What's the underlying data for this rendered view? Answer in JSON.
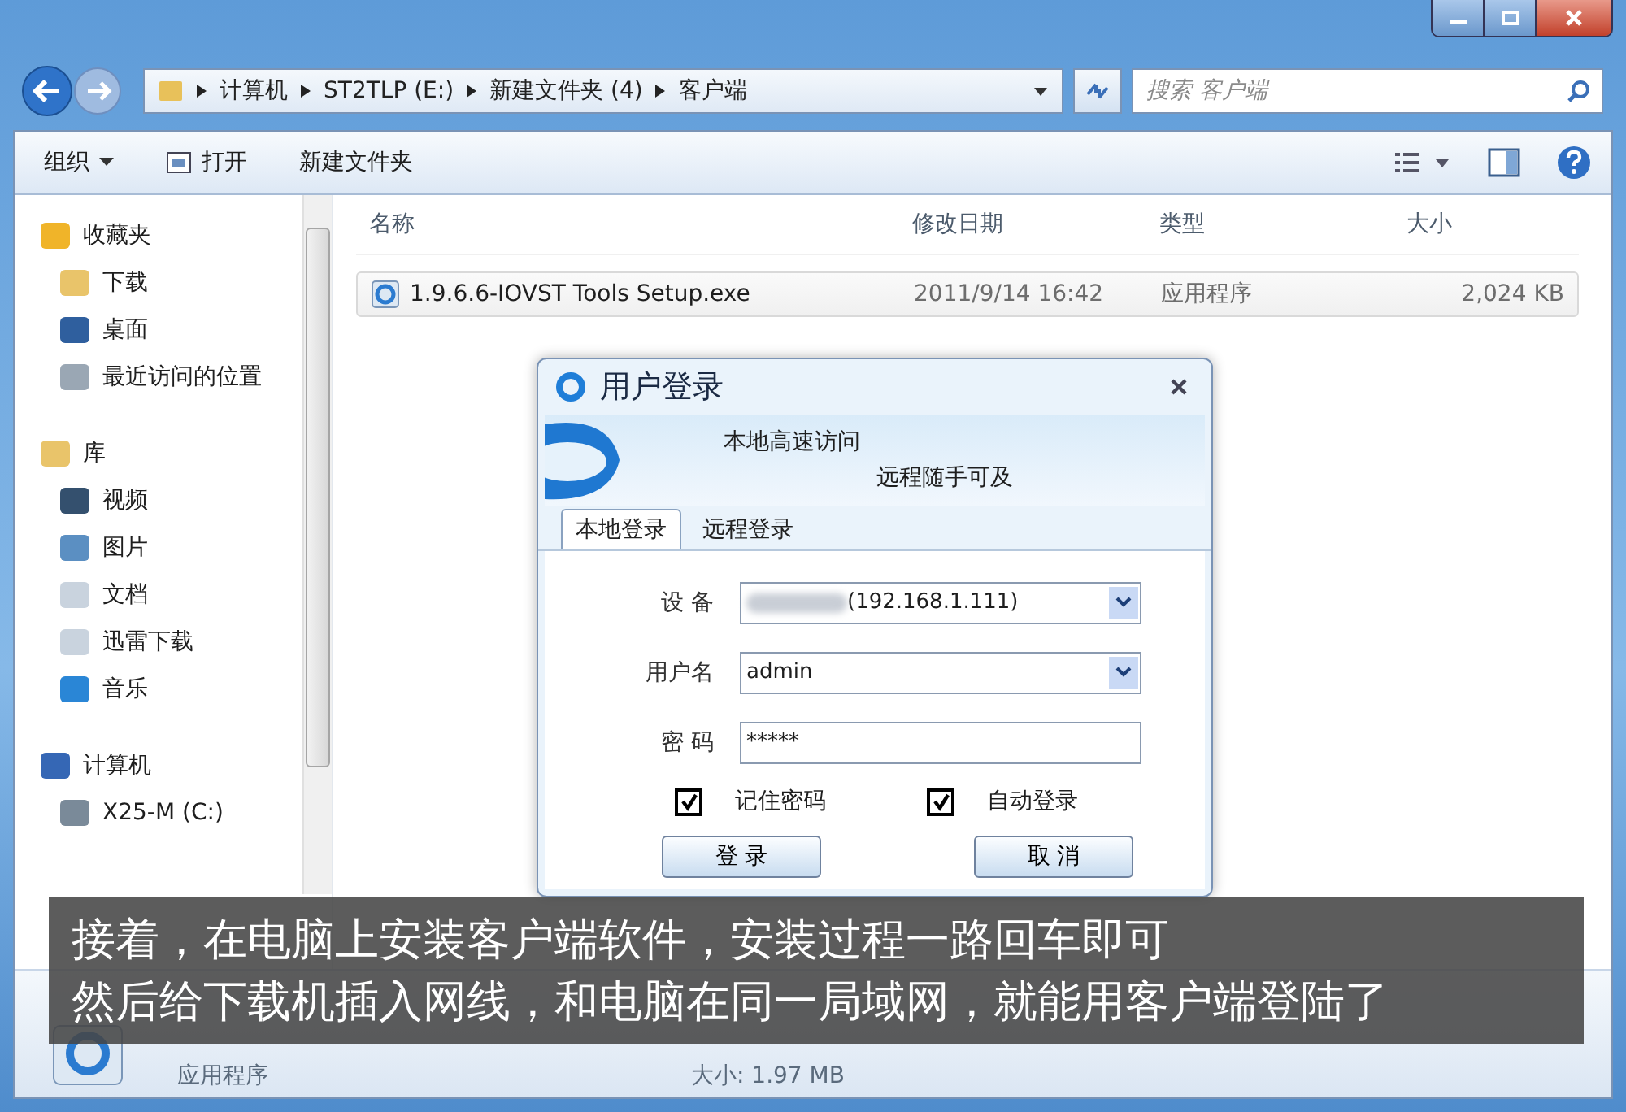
{
  "address_bar": {
    "crumbs": [
      "计算机",
      "ST2TLP (E:)",
      "新建文件夹 (4)",
      "客户端"
    ]
  },
  "search": {
    "placeholder": "搜索 客户端"
  },
  "toolbar": {
    "items": [
      {
        "label": "组织",
        "kind": "menu"
      },
      {
        "label": "打开",
        "kind": "open"
      },
      {
        "label": "新建文件夹",
        "kind": "plain"
      }
    ]
  },
  "sidebar": {
    "groups": [
      {
        "label": "收藏夹",
        "kind": "star",
        "children": [
          {
            "label": "下载",
            "kind": "download"
          },
          {
            "label": "桌面",
            "kind": "desktop"
          },
          {
            "label": "最近访问的位置",
            "kind": "recent"
          }
        ]
      },
      {
        "label": "库",
        "kind": "library",
        "children": [
          {
            "label": "视频",
            "kind": "video"
          },
          {
            "label": "图片",
            "kind": "picture"
          },
          {
            "label": "文档",
            "kind": "doc"
          },
          {
            "label": "迅雷下载",
            "kind": "doc"
          },
          {
            "label": "音乐",
            "kind": "music"
          }
        ]
      },
      {
        "label": "计算机",
        "kind": "computer",
        "children": [
          {
            "label": "X25-M (C:)",
            "kind": "drive"
          }
        ]
      }
    ]
  },
  "table": {
    "columns": [
      "名称",
      "修改日期",
      "类型",
      "大小"
    ],
    "rows": [
      {
        "name": "1.9.6.6-IOVST Tools Setup.exe",
        "modified": "2011/9/14 16:42",
        "type": "应用程序",
        "size": "2,024 KB",
        "selected": false
      }
    ]
  },
  "details_pane": {
    "type": "应用程序",
    "size": "大小: 1.97 MB"
  },
  "dialog": {
    "title": "用户登录",
    "banner": [
      "本地高速访问",
      "远程随手可及"
    ],
    "tabs": [
      {
        "label": "本地登录",
        "selected": true
      },
      {
        "label": "远程登录",
        "selected": false
      }
    ],
    "fields": [
      {
        "label": "设 备",
        "value": "(192.168.1.111)",
        "kind": "device"
      },
      {
        "label": "用户名",
        "value": "admin",
        "kind": "combo"
      },
      {
        "label": "密 码",
        "value": "*****",
        "kind": "password"
      }
    ],
    "checkboxes": [
      {
        "label": "记住密码",
        "checked": true
      },
      {
        "label": "自动登录",
        "checked": true
      }
    ],
    "buttons": [
      "登 录",
      "取 消"
    ]
  },
  "caption": [
    "接着，在电脑上安装客户端软件，安装过程一路回车即可",
    "然后给下载机插入网线，和电脑在同一局域网，就能用客户端登陆了"
  ]
}
